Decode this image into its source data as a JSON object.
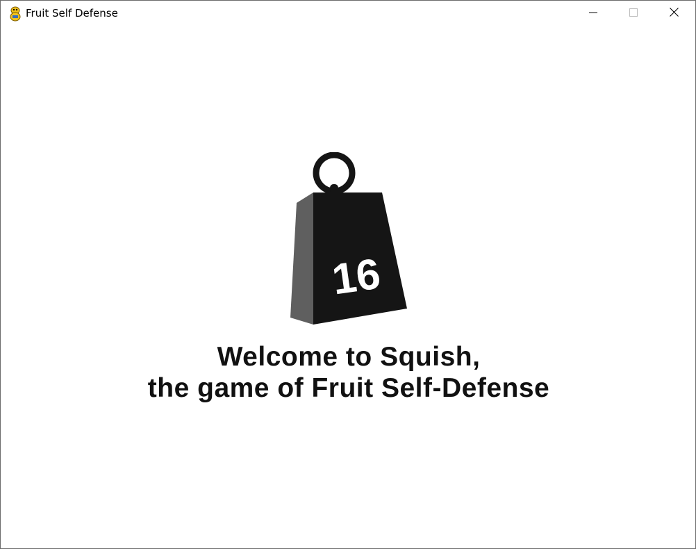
{
  "window": {
    "title": "Fruit Self Defense"
  },
  "title_bar": {
    "icon": "python-snake-icon",
    "buttons": [
      "minimize",
      "maximize",
      "close"
    ]
  },
  "weight": {
    "icon": "kettlebell-weight-icon",
    "label": "16"
  },
  "welcome": {
    "line1": "Welcome to Squish,",
    "line2": "the game of Fruit Self-Defense"
  }
}
